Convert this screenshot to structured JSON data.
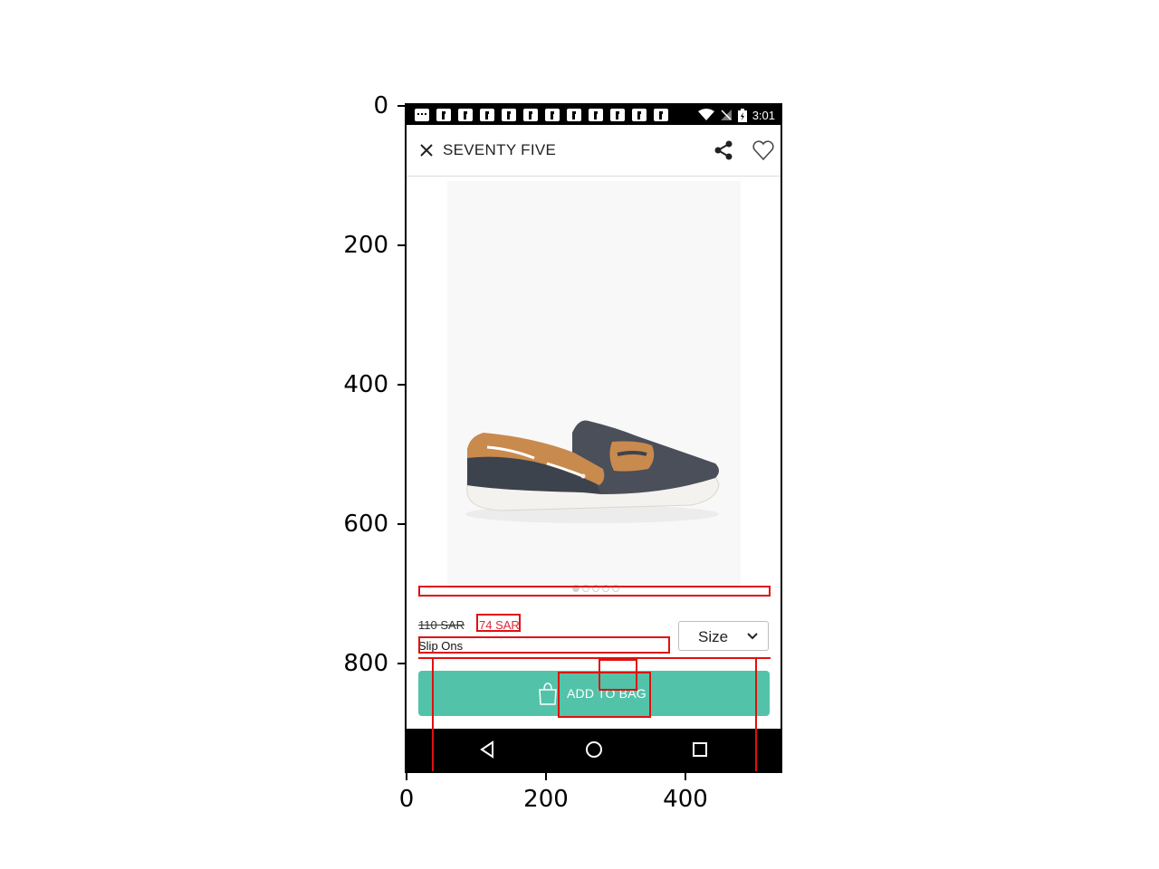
{
  "axes": {
    "y_ticks": [
      "0",
      "200",
      "400",
      "600",
      "800"
    ],
    "x_ticks": [
      "0",
      "200",
      "400"
    ]
  },
  "status_bar": {
    "time": "3:01",
    "icons": [
      "message-icon",
      "facebook-icon",
      "wifi-icon",
      "no-signal-icon",
      "battery-charging-icon"
    ]
  },
  "header": {
    "title": "SEVENTY FIVE",
    "icons": [
      "close-icon",
      "share-icon",
      "heart-icon"
    ]
  },
  "product": {
    "image_desc": "",
    "pager_count": 5,
    "pager_active": 0,
    "old_price": "110 SAR",
    "new_price": "74 SAR",
    "name": "Slip Ons"
  },
  "size_select": {
    "label": "Size",
    "icon": "chevron-down-icon"
  },
  "cta": {
    "label": "ADD TO BAG",
    "icon": "shopping-bag-icon",
    "color": "#52c3a9"
  },
  "nav": {
    "icons": [
      "back-icon",
      "home-icon",
      "recents-icon"
    ]
  },
  "colors": {
    "sale_price": "#e0243a",
    "annotation": "#e01010"
  }
}
